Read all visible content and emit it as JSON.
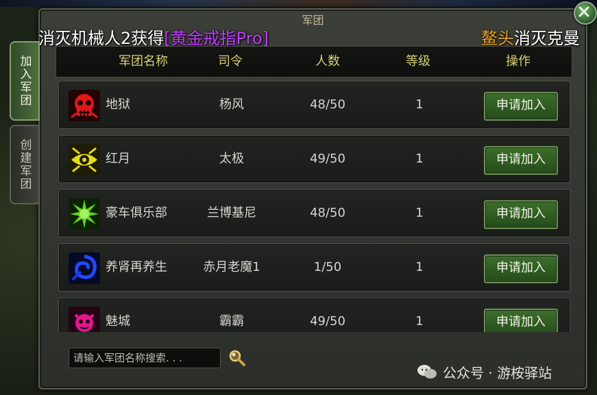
{
  "window": {
    "title": "军团"
  },
  "announcement": {
    "prefix": "消灭机械人2获得",
    "item": "[黄金戒指Pro]",
    "player": "鳌头",
    "action": "消灭克曼"
  },
  "side_tabs": [
    {
      "label": "加入军团",
      "active": true
    },
    {
      "label": "创建军团",
      "active": false
    }
  ],
  "table": {
    "headers": [
      "军团名称",
      "司令",
      "人数",
      "等级",
      "操作"
    ],
    "rows": [
      {
        "name": "地狱",
        "leader": "杨风",
        "members": "48/50",
        "level": "1",
        "action": "申请加入",
        "emblem_color": "#e01818",
        "emblem_icon": "skull-icon"
      },
      {
        "name": "红月",
        "leader": "太极",
        "members": "49/50",
        "level": "1",
        "action": "申请加入",
        "emblem_color": "#e6dc1a",
        "emblem_icon": "eye-icon"
      },
      {
        "name": "豪车俱乐部",
        "leader": "兰博基尼",
        "members": "48/50",
        "level": "1",
        "action": "申请加入",
        "emblem_color": "#62d41c",
        "emblem_icon": "spiky-orb-icon"
      },
      {
        "name": "养肾再养生",
        "leader": "赤月老魔1",
        "members": "1/50",
        "level": "1",
        "action": "申请加入",
        "emblem_color": "#1a36e6",
        "emblem_icon": "swirl-icon"
      },
      {
        "name": "魅城",
        "leader": "霸霸",
        "members": "49/50",
        "level": "1",
        "action": "申请加入",
        "emblem_color": "#e0188c",
        "emblem_icon": "demon-face-icon"
      }
    ]
  },
  "search": {
    "placeholder": "请输入军团名称搜索. . ."
  },
  "watermark": {
    "text": "公众号 · 游桉驿站"
  }
}
